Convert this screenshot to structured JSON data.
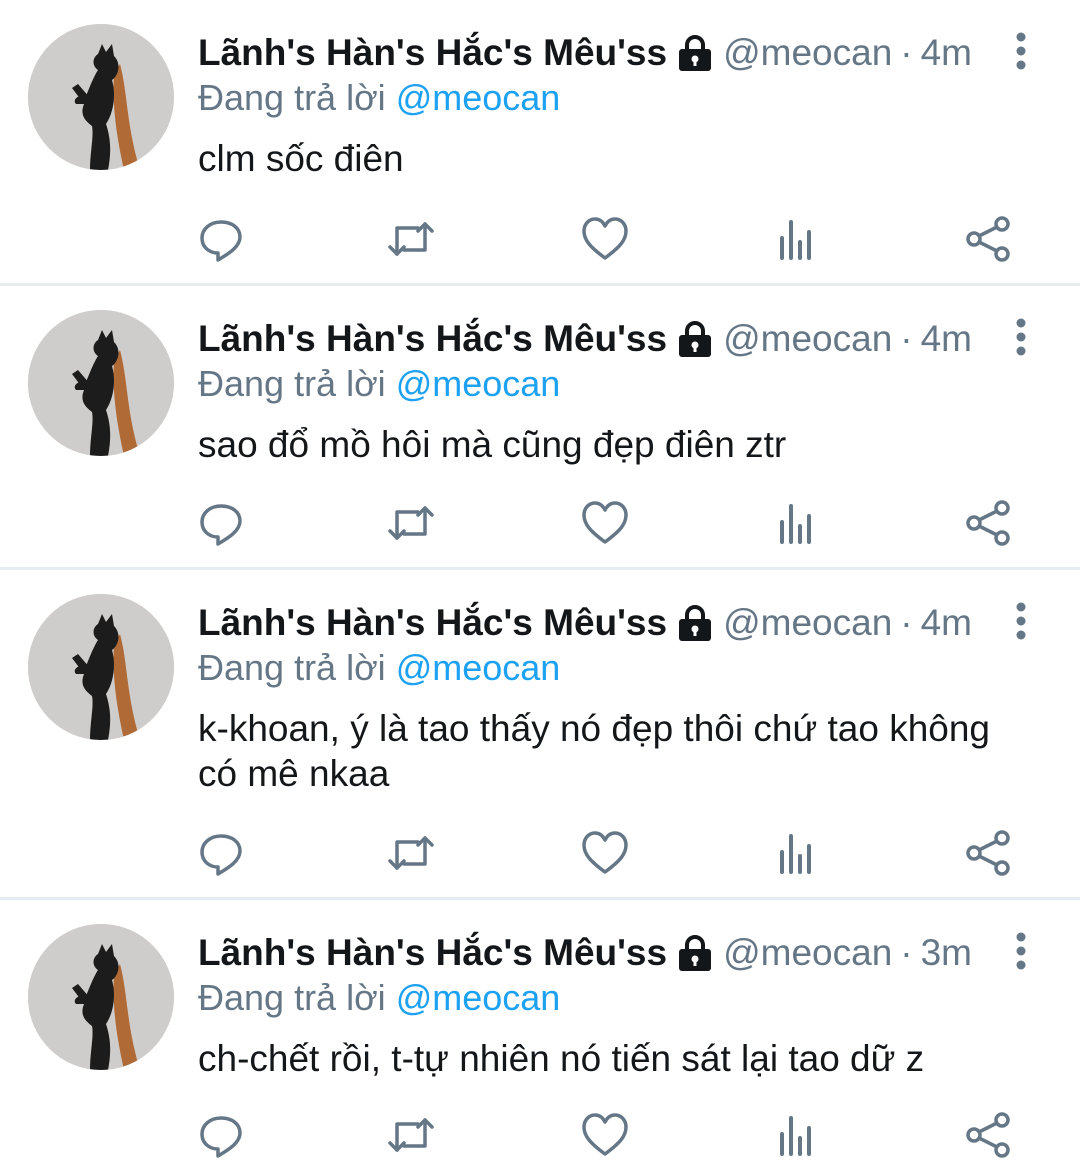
{
  "tweets": [
    {
      "display_name": "Lãnh's Hàn's Hắc's Mêu'ss",
      "handle": "@meocan",
      "separator": "·",
      "time": "4m",
      "replying_prefix": "Đang trả lời",
      "replying_to": "@meocan",
      "text": "clm sốc điên"
    },
    {
      "display_name": "Lãnh's Hàn's Hắc's Mêu'ss",
      "handle": "@meocan",
      "separator": "·",
      "time": "4m",
      "replying_prefix": "Đang trả lời",
      "replying_to": "@meocan",
      "text": "sao đổ mồ hôi mà cũng đẹp điên ztr"
    },
    {
      "display_name": "Lãnh's Hàn's Hắc's Mêu'ss",
      "handle": "@meocan",
      "separator": "·",
      "time": "4m",
      "replying_prefix": "Đang trả lời",
      "replying_to": "@meocan",
      "text": "k-khoan, ý là tao thấy nó đẹp thôi chứ tao không có mê nkaa"
    },
    {
      "display_name": "Lãnh's Hàn's Hắc's Mêu'ss",
      "handle": "@meocan",
      "separator": "·",
      "time": "3m",
      "replying_prefix": "Đang trả lời",
      "replying_to": "@meocan",
      "text": "ch-chết rồi, t-tự nhiên nó tiến sát lại tao dữ z"
    }
  ],
  "icons": {
    "lock": "lock-icon",
    "more": "more-vertical-icon",
    "reply": "reply-icon",
    "retweet": "retweet-icon",
    "like": "heart-icon",
    "analytics": "analytics-icon",
    "share": "share-icon"
  },
  "colors": {
    "text": "#14171a",
    "muted": "#657786",
    "mention": "#1da1f2",
    "divider": "#e6ecf0"
  }
}
